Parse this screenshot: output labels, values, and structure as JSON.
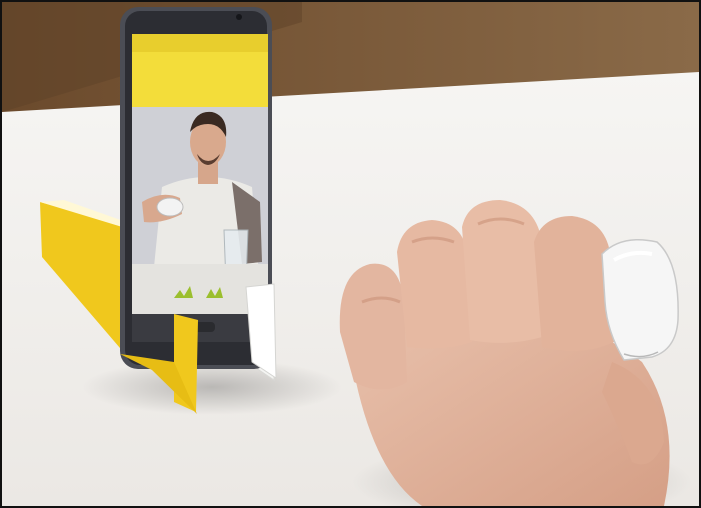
{
  "scene": {
    "description_tags": [
      "smartphone-on-stand",
      "video-call",
      "hand-with-ring-device"
    ],
    "colors": {
      "wall_wood": "#6b4a2c",
      "table": "#f1efec",
      "stand_yellow": "#f0c81d",
      "app_bar_yellow": "#f3dd3a",
      "phone_body": "#4b4d55",
      "skin": "#e2b49d",
      "ring_device": "#f4f4f4"
    },
    "phone": {
      "screen_text": "",
      "call_overlay_icons": [
        "hand-gesture-icon",
        "hand-gesture-icon"
      ]
    }
  }
}
